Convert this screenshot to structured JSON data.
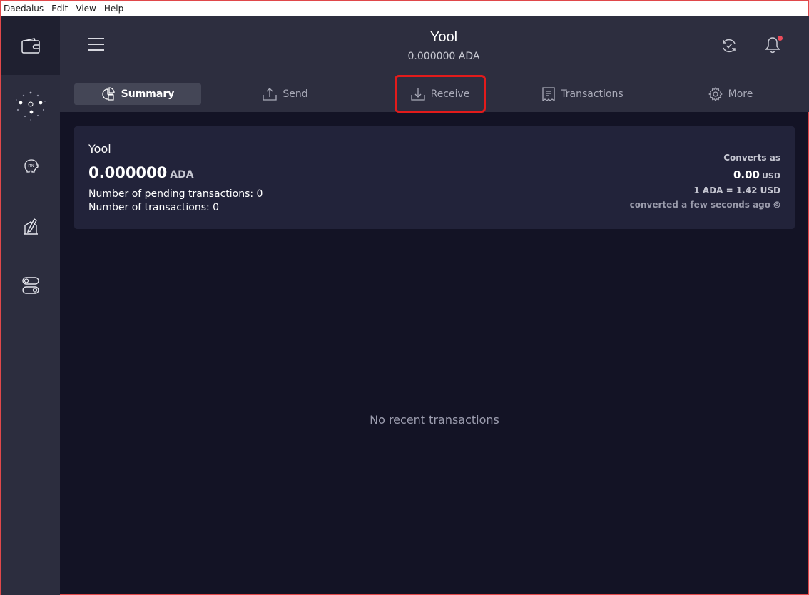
{
  "menubar": {
    "items": [
      "Daedalus",
      "Edit",
      "View",
      "Help"
    ]
  },
  "header": {
    "wallet_name": "Yool",
    "wallet_balance": "0.000000 ADA"
  },
  "tabs": [
    {
      "label": "Summary",
      "icon": "pie-chart-icon",
      "active": true
    },
    {
      "label": "Send",
      "icon": "upload-icon",
      "active": false
    },
    {
      "label": "Receive",
      "icon": "download-icon",
      "active": false,
      "highlighted": true
    },
    {
      "label": "Transactions",
      "icon": "receipt-icon",
      "active": false
    },
    {
      "label": "More",
      "icon": "gear-icon",
      "active": false
    }
  ],
  "summary": {
    "name": "Yool",
    "amount": "0.000000",
    "unit": "ADA",
    "pending_line": "Number of pending transactions: 0",
    "tx_line": "Number of transactions: 0",
    "converts_label": "Converts as",
    "converted_value": "0.00",
    "converted_unit": "USD",
    "rate": "1 ADA = 1.42 USD",
    "converted_time": "converted a few seconds ago"
  },
  "empty_state": "No recent transactions",
  "colors": {
    "sidebar": "#2c2d3e",
    "topbar": "#2d2e3f",
    "content_bg": "#131325",
    "card_bg": "#22233a",
    "highlight": "#e21b1b",
    "notification_dot": "#ea4c5b"
  }
}
